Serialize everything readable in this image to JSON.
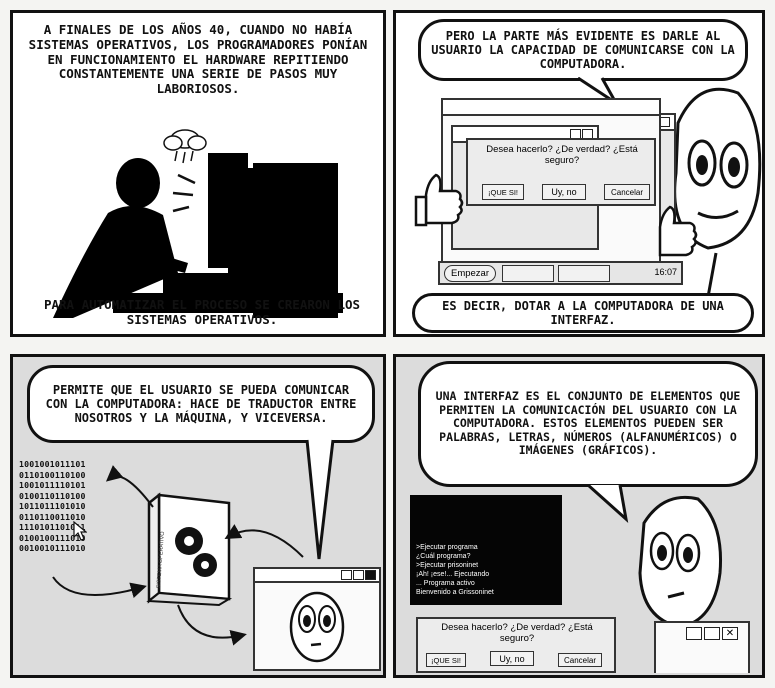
{
  "panel1": {
    "top_text": "A finales de los años 40, cuando no había sistemas operativos, los programadores ponían en funcionamiento el hardware repitiendo constantemente una serie de pasos muy laboriosos.",
    "bottom_text": "Para automatizar el proceso se crearon los sistemas operativos."
  },
  "panel2": {
    "bubble_top": "Pero la parte más evidente es darle al usuario la capacidad de comunicarse con la computadora.",
    "bubble_bottom": "Es decir, dotar a la computadora de una interfaz.",
    "dialog_question": "Desea hacerlo? ¿De verdad? ¿Está seguro?",
    "dialog_buttons": [
      "¡QUE SI!",
      "Uy, no",
      "Cancelar"
    ],
    "taskbar_start": "Empezar",
    "taskbar_clock": "16:07"
  },
  "panel3": {
    "bubble": "Permite que el usuario se pueda comunicar con la computadora: hace de traductor entre nosotros y la máquina, y viceversa.",
    "binary": "1001001011101\n0110100110100\n1001011110101\n0100110110100\n1011011101010\n0110110011010\n1110101101011\n0100100111010\n0010010111010",
    "book_spine": "SISTEMA OPERATIVO"
  },
  "panel4": {
    "bubble": "Una interfaz es el conjunto de elementos que permiten la comunicación del usuario con la computadora. Estos elementos pueden ser palabras, letras, números (alfanuméricos) o imágenes (gráficos).",
    "terminal_lines": [
      ">Ejecutar programa",
      "¿Cuál programa?",
      ">Ejecutar prisoninet",
      "¡Ah! ¡ese!... Ejecutando",
      "... Programa activo",
      "Bienvenido a Grissoninet"
    ],
    "dialog_question": "Desea hacerlo? ¿De verdad? ¿Está seguro?",
    "dialog_buttons": [
      "¡QUE SI!",
      "Uy, no",
      "Cancelar"
    ]
  }
}
